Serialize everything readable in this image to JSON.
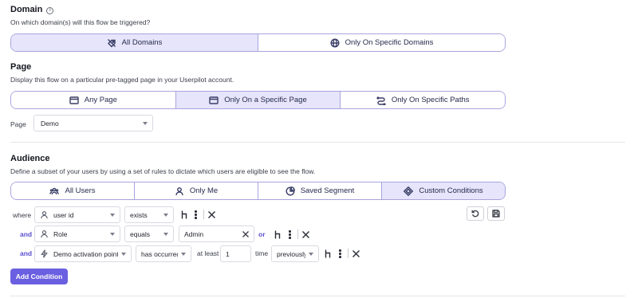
{
  "domain": {
    "title": "Domain",
    "info_icon": "ⓘ",
    "description": "On which domain(s) will this flow be triggered?",
    "options": [
      {
        "label": "All Domains",
        "icon": "domain-tag-icon",
        "active": true
      },
      {
        "label": "Only On Specific Domains",
        "icon": "globe-icon",
        "active": false
      }
    ]
  },
  "page": {
    "title": "Page",
    "description": "Display this flow on a particular pre-tagged page in your Userpilot account.",
    "options": [
      {
        "label": "Any Page",
        "icon": "browser-window-icon",
        "active": false
      },
      {
        "label": "Only On a Specific Page",
        "icon": "browser-window-icon",
        "active": true
      },
      {
        "label": "Only On Specific Paths",
        "icon": "path-route-icon",
        "active": false
      }
    ],
    "select_label": "Page",
    "select_value": "Demo"
  },
  "audience": {
    "title": "Audience",
    "description": "Define a subset of your users by using a set of rules to dictate which users are eligible to see the flow.",
    "options": [
      {
        "label": "All Users",
        "icon": "users-group-icon",
        "active": false
      },
      {
        "label": "Only Me",
        "icon": "user-icon",
        "active": false
      },
      {
        "label": "Saved Segment",
        "icon": "pie-segment-icon",
        "active": false
      },
      {
        "label": "Custom Conditions",
        "icon": "diamond-conditions-icon",
        "active": true
      }
    ],
    "conditions": [
      {
        "connector": "where",
        "field": "user id",
        "field_icon": "user-icon",
        "operator": "exists"
      },
      {
        "connector": "and",
        "field": "Role",
        "field_icon": "user-icon",
        "operator": "equals",
        "value": "Admin",
        "or_label": "or"
      },
      {
        "connector": "and",
        "field": "Demo activation point",
        "field_icon": "lightning-icon",
        "operator": "has occurred",
        "at_least_label": "at least",
        "count": "1",
        "time_label": "time",
        "period": "previously"
      }
    ],
    "add_condition_label": "Add Condition",
    "accent_color": "#6a5fe0",
    "active_fill": "#e6e5fb"
  }
}
